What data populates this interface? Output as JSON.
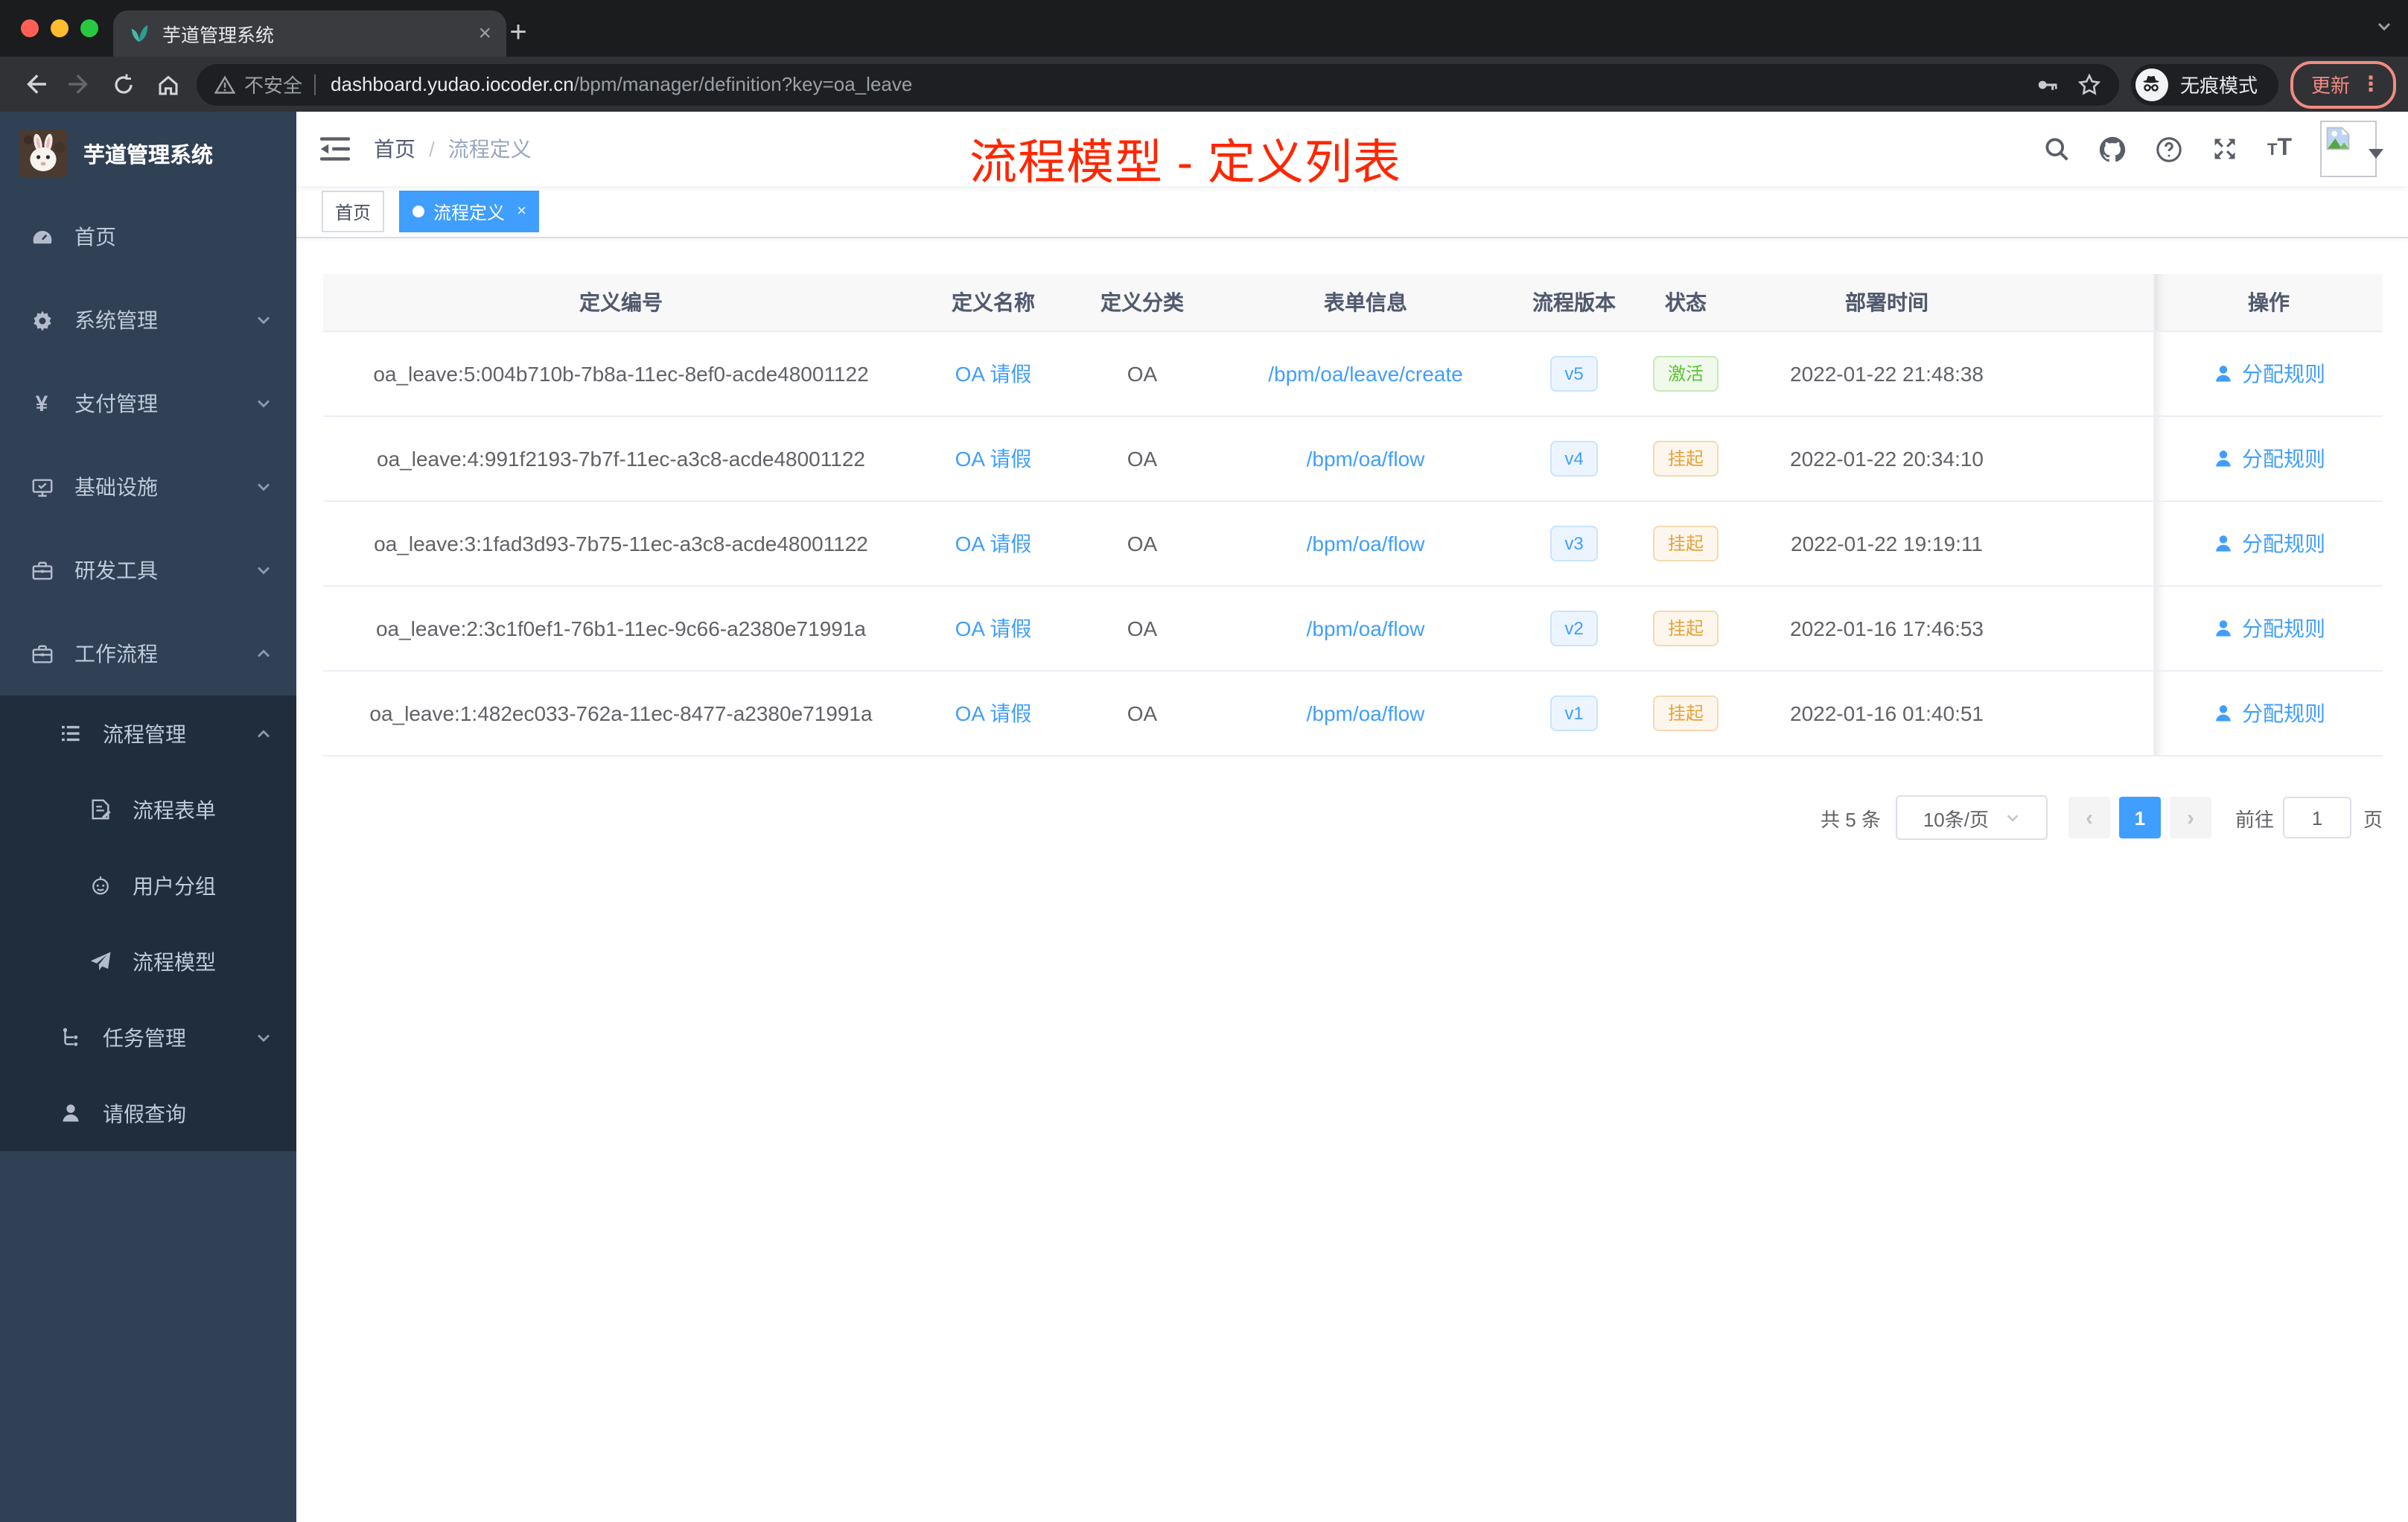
{
  "colors": {
    "primary": "#409eff",
    "success": "#5dc239",
    "warning": "#e6a23c",
    "annotation_red": "#ff2600",
    "sidebar_bg": "#304156",
    "submenu_bg": "#1f2d3d"
  },
  "browser": {
    "tab_title": "芋道管理系统",
    "tab_close": "×",
    "new_tab": "+",
    "security": "不安全",
    "url_host": "dashboard.yudao.iocoder.cn",
    "url_path": "/bpm/manager/definition?key=oa_leave",
    "incognito": "无痕模式",
    "update": "更新",
    "update_dots": "⋮"
  },
  "app": {
    "annotation": "流程模型 - 定义列表",
    "sidebar": {
      "title": "芋道管理系统",
      "menu": [
        {
          "key": "home",
          "label": "首页",
          "icon": "dashboard",
          "state": "none"
        },
        {
          "key": "system-mgmt",
          "label": "系统管理",
          "icon": "gear",
          "state": "collapsed"
        },
        {
          "key": "payment-mgmt",
          "label": "支付管理",
          "icon": "yuan",
          "state": "collapsed"
        },
        {
          "key": "infrastructure",
          "label": "基础设施",
          "icon": "monitor",
          "state": "collapsed"
        },
        {
          "key": "dev-tools",
          "label": "研发工具",
          "icon": "toolbox",
          "state": "collapsed"
        },
        {
          "key": "workflow",
          "label": "工作流程",
          "icon": "toolbox",
          "state": "expanded"
        }
      ],
      "submenu": [
        {
          "key": "process-mgmt",
          "label": "流程管理",
          "icon": "list",
          "state": "expanded",
          "level": 1
        },
        {
          "key": "process-form",
          "label": "流程表单",
          "icon": "form",
          "state": "none",
          "level": 2
        },
        {
          "key": "user-group",
          "label": "用户分组",
          "icon": "robot",
          "state": "none",
          "level": 2
        },
        {
          "key": "process-model",
          "label": "流程模型",
          "icon": "paper-plane",
          "state": "none",
          "level": 2
        },
        {
          "key": "task-mgmt",
          "label": "任务管理",
          "icon": "tree",
          "state": "collapsed",
          "level": 1
        },
        {
          "key": "leave-query",
          "label": "请假查询",
          "icon": "user",
          "state": "none",
          "level": 1
        }
      ]
    },
    "navbar": {
      "breadcrumb": [
        "首页",
        "流程定义"
      ]
    },
    "tags": [
      {
        "label": "首页",
        "active": false,
        "closable": false
      },
      {
        "label": "流程定义",
        "active": true,
        "closable": true,
        "close": "×"
      }
    ],
    "table": {
      "columns": [
        "定义编号",
        "定义名称",
        "定义分类",
        "表单信息",
        "流程版本",
        "状态",
        "部署时间",
        "操作"
      ],
      "rows": [
        {
          "id": "oa_leave:5:004b710b-7b8a-11ec-8ef0-acde48001122",
          "name": "OA 请假",
          "category": "OA",
          "form": "/bpm/oa/leave/create",
          "version": "v5",
          "status": "激活",
          "status_type": "success",
          "time": "2022-01-22 21:48:38",
          "action": "分配规则"
        },
        {
          "id": "oa_leave:4:991f2193-7b7f-11ec-a3c8-acde48001122",
          "name": "OA 请假",
          "category": "OA",
          "form": "/bpm/oa/flow",
          "version": "v4",
          "status": "挂起",
          "status_type": "warning",
          "time": "2022-01-22 20:34:10",
          "action": "分配规则"
        },
        {
          "id": "oa_leave:3:1fad3d93-7b75-11ec-a3c8-acde48001122",
          "name": "OA 请假",
          "category": "OA",
          "form": "/bpm/oa/flow",
          "version": "v3",
          "status": "挂起",
          "status_type": "warning",
          "time": "2022-01-22 19:19:11",
          "action": "分配规则"
        },
        {
          "id": "oa_leave:2:3c1f0ef1-76b1-11ec-9c66-a2380e71991a",
          "name": "OA 请假",
          "category": "OA",
          "form": "/bpm/oa/flow",
          "version": "v2",
          "status": "挂起",
          "status_type": "warning",
          "time": "2022-01-16 17:46:53",
          "action": "分配规则"
        },
        {
          "id": "oa_leave:1:482ec033-762a-11ec-8477-a2380e71991a",
          "name": "OA 请假",
          "category": "OA",
          "form": "/bpm/oa/flow",
          "version": "v1",
          "status": "挂起",
          "status_type": "warning",
          "time": "2022-01-16 01:40:51",
          "action": "分配规则"
        }
      ]
    },
    "pagination": {
      "total": "共 5 条",
      "page_size": "10条/页",
      "prev": "‹",
      "current": "1",
      "next": "›",
      "goto": "前往",
      "goto_value": "1",
      "unit": "页"
    }
  }
}
